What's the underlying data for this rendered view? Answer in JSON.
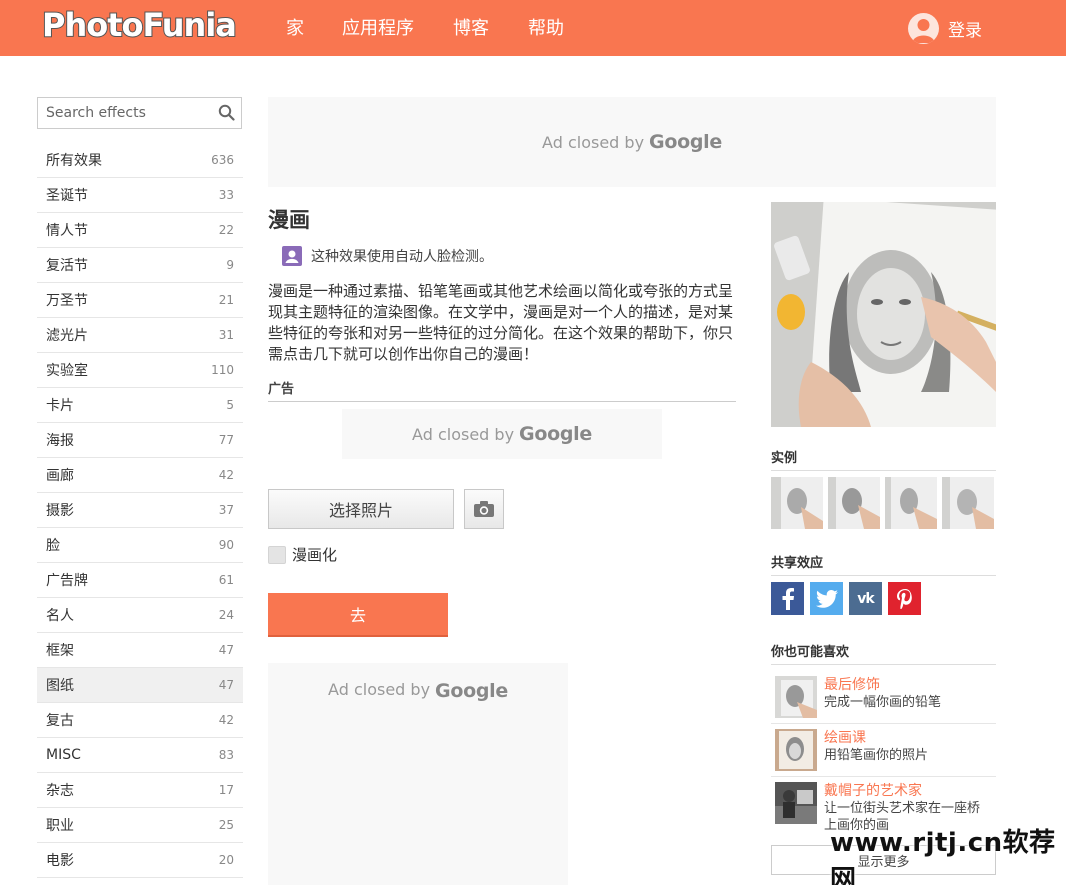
{
  "header": {
    "logo_part1": "Photo",
    "logo_part2": "Funia",
    "nav": [
      "家",
      "应用程序",
      "博客",
      "帮助"
    ],
    "login": "登录",
    "bar_color": "#f97650"
  },
  "sidebar": {
    "search_placeholder": "Search effects",
    "categories": [
      {
        "name": "所有效果",
        "count": "636"
      },
      {
        "name": "圣诞节",
        "count": "33"
      },
      {
        "name": "情人节",
        "count": "22"
      },
      {
        "name": "复活节",
        "count": "9"
      },
      {
        "name": "万圣节",
        "count": "21"
      },
      {
        "name": "滤光片",
        "count": "31"
      },
      {
        "name": "实验室",
        "count": "110"
      },
      {
        "name": "卡片",
        "count": "5"
      },
      {
        "name": "海报",
        "count": "77"
      },
      {
        "name": "画廊",
        "count": "42"
      },
      {
        "name": "摄影",
        "count": "37"
      },
      {
        "name": "脸",
        "count": "90"
      },
      {
        "name": "广告牌",
        "count": "61"
      },
      {
        "name": "名人",
        "count": "24"
      },
      {
        "name": "框架",
        "count": "47"
      },
      {
        "name": "图纸",
        "count": "47"
      },
      {
        "name": "复古",
        "count": "42"
      },
      {
        "name": "MISC",
        "count": "83"
      },
      {
        "name": "杂志",
        "count": "17"
      },
      {
        "name": "职业",
        "count": "25"
      },
      {
        "name": "电影",
        "count": "20"
      }
    ]
  },
  "ads": {
    "closed_text": "Ad closed by",
    "google": "Google"
  },
  "main": {
    "title": "漫画",
    "face_detection": "这种效果使用自动人脸检测。",
    "description": "漫画是一种通过素描、铅笔笔画或其他艺术绘画以简化或夸张的方式呈现其主题特征的渲染图像。在文学中，漫画是对一个人的描述，是对某些特征的夸张和对另一些特征的过分简化。在这个效果的帮助下，你只需点击几下就可以创作出你自己的漫画！",
    "ad_label": "广告",
    "choose_photo": "选择照片",
    "checkbox_label": "漫画化",
    "go_button": "去"
  },
  "right": {
    "examples_heading": "实例",
    "share_heading": "共享效应",
    "share_icons": [
      {
        "name": "facebook-icon",
        "glyph": "f",
        "color": "#3b5998"
      },
      {
        "name": "twitter-icon",
        "glyph": "t",
        "color": "#55acee"
      },
      {
        "name": "vk-icon",
        "glyph": "vk",
        "color": "#4c6c91"
      },
      {
        "name": "pinterest-icon",
        "glyph": "p",
        "color": "#e0232e"
      }
    ],
    "related_heading": "你也可能喜欢",
    "related": [
      {
        "title": "最后修饰",
        "desc": "完成一幅你画的铅笔"
      },
      {
        "title": "绘画课",
        "desc": "用铅笔画你的照片"
      },
      {
        "title": "戴帽子的艺术家",
        "desc": "让一位街头艺术家在一座桥上画你的画"
      }
    ],
    "show_more": "显示更多"
  },
  "watermark": "www.rjtj.cn软荐网"
}
